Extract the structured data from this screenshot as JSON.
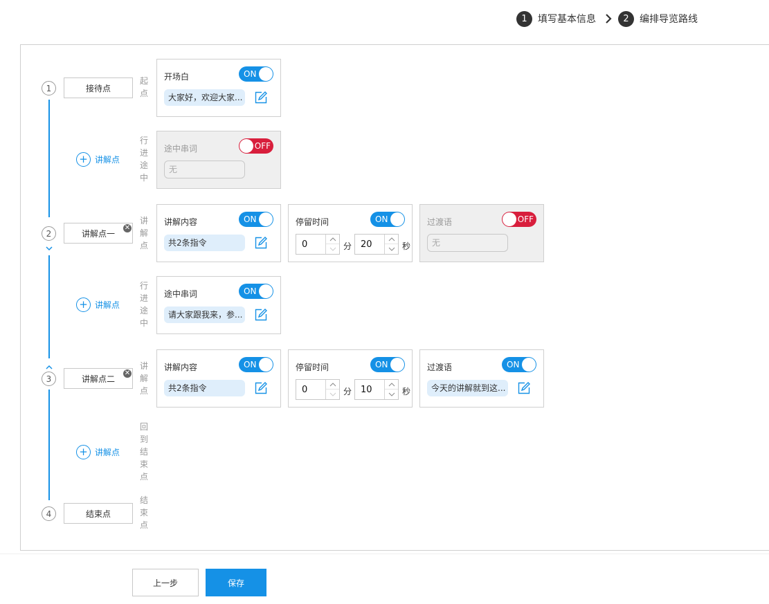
{
  "steps": [
    {
      "num": "1",
      "label": "填写基本信息"
    },
    {
      "num": "2",
      "label": "编排导览路线"
    }
  ],
  "nodes": [
    {
      "num": "1",
      "name": "接待点",
      "side_label": "起点"
    },
    {
      "num": "2",
      "name": "讲解点一",
      "side_label": "讲解点"
    },
    {
      "num": "3",
      "name": "讲解点二",
      "side_label": "讲解点"
    },
    {
      "num": "4",
      "name": "结束点",
      "side_label": "结束点"
    }
  ],
  "segments": [
    {
      "side_label": "行进途中",
      "add_label": "讲解点"
    },
    {
      "side_label": "行进途中",
      "add_label": "讲解点"
    },
    {
      "side_label": "回到结束点",
      "add_label": "讲解点"
    }
  ],
  "cards": {
    "opening": {
      "title": "开场白",
      "toggle": "ON",
      "chip": "大家好，欢迎大家..."
    },
    "seg1_talk": {
      "title": "途中串词",
      "toggle": "OFF",
      "chip": "无"
    },
    "n2_content": {
      "title": "讲解内容",
      "toggle": "ON",
      "chip": "共2条指令"
    },
    "n2_stay": {
      "title": "停留时间",
      "toggle": "ON",
      "minutes": "0",
      "seconds": "20",
      "min_unit": "分",
      "sec_unit": "秒"
    },
    "n2_transition": {
      "title": "过渡语",
      "toggle": "OFF",
      "chip": "无"
    },
    "seg2_talk": {
      "title": "途中串词",
      "toggle": "ON",
      "chip": "请大家跟我来，参..."
    },
    "n3_content": {
      "title": "讲解内容",
      "toggle": "ON",
      "chip": "共2条指令"
    },
    "n3_stay": {
      "title": "停留时间",
      "toggle": "ON",
      "minutes": "0",
      "seconds": "10",
      "min_unit": "分",
      "sec_unit": "秒"
    },
    "n3_transition": {
      "title": "过渡语",
      "toggle": "ON",
      "chip": "今天的讲解就到这..."
    }
  },
  "buttons": {
    "prev": "上一步",
    "save": "保存"
  },
  "colors": {
    "accent": "#1591e6",
    "off": "#d81e3c",
    "chip_bg": "#dfeefb"
  }
}
